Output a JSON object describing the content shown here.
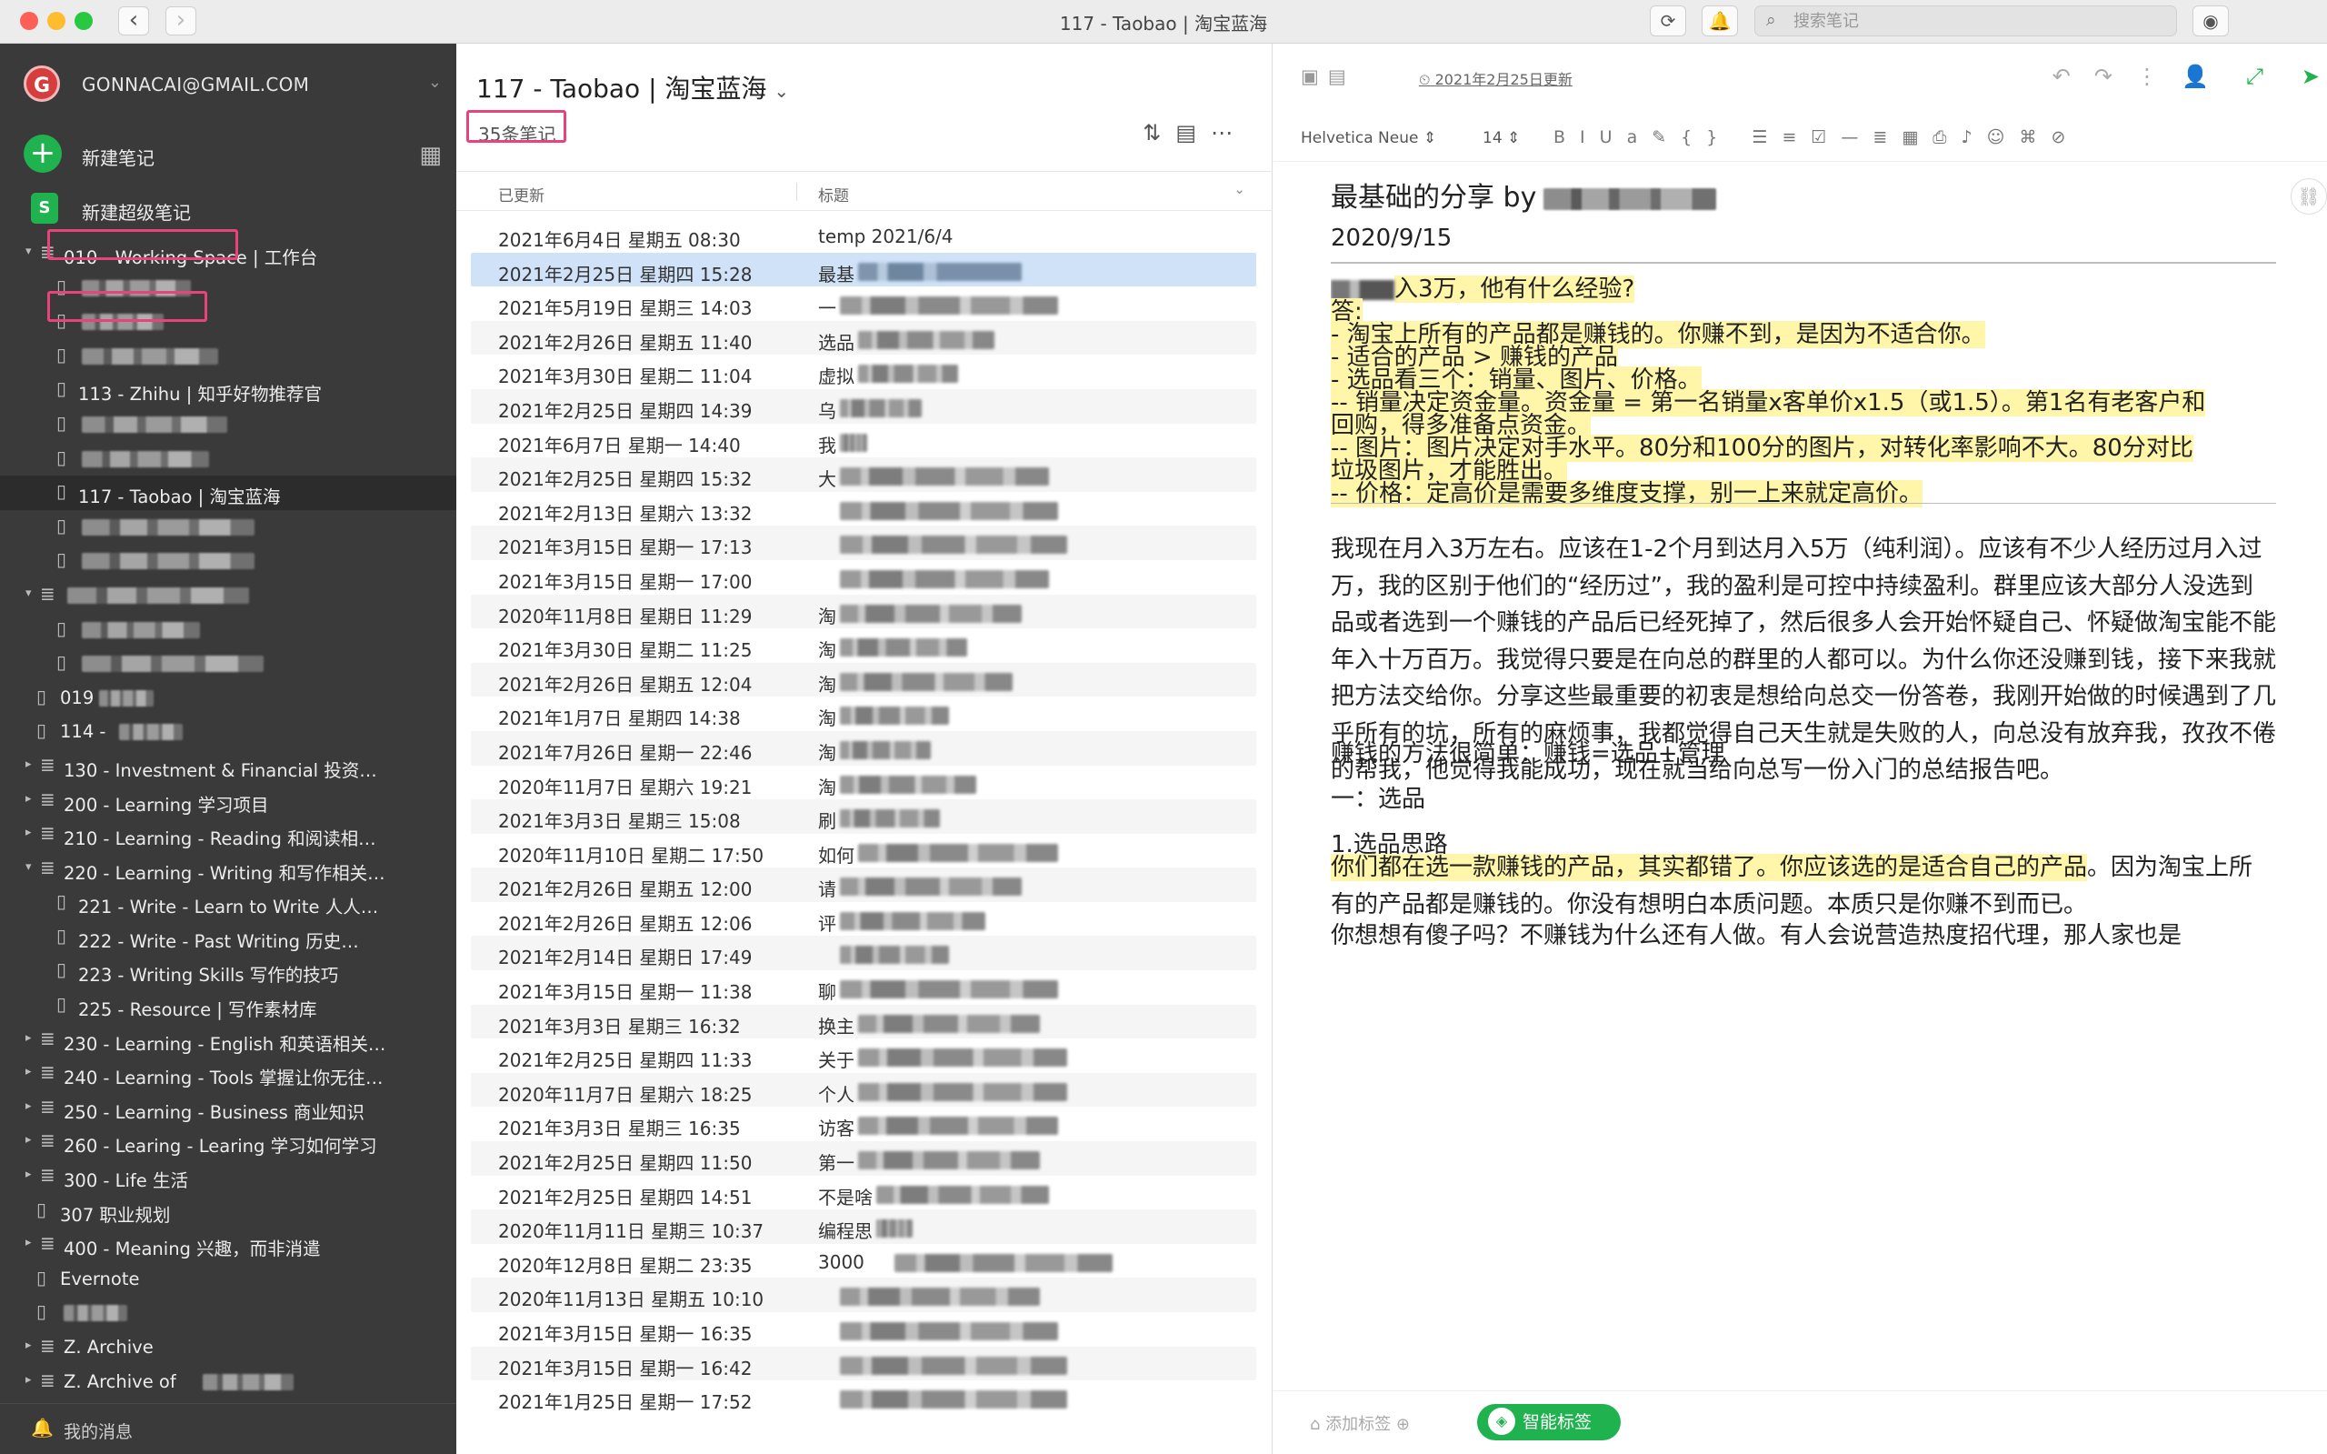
{
  "window": {
    "title": "117 - Taobao | 淘宝蓝海",
    "search_placeholder": "搜索笔记",
    "icons": {
      "sync": "sync-icon",
      "bell": "bell-icon",
      "search": "search-icon",
      "account": "account-icon"
    }
  },
  "sidebar": {
    "account_email": "GONNACAI@GMAIL.COM",
    "avatar_letter": "G",
    "new_note": "新建笔记",
    "new_super_note": "新建超级笔记",
    "super_icon_letter": "S",
    "footer": "我的消息",
    "tree": [
      {
        "label": "010 - Working Space | 工作台",
        "level": 0,
        "arrow": "▾",
        "icon": "stack"
      },
      {
        "label": "",
        "level": 1,
        "icon": "notebook",
        "blurred": 120
      },
      {
        "label": "",
        "level": 1,
        "icon": "notebook",
        "blurred": 90
      },
      {
        "label": "",
        "level": 1,
        "icon": "notebook",
        "blurred": 150
      },
      {
        "label": "113 - Zhihu | 知乎好物推荐官",
        "level": 1,
        "icon": "notebook"
      },
      {
        "label": "",
        "level": 1,
        "icon": "notebook",
        "blurred": 160
      },
      {
        "label": "",
        "level": 1,
        "icon": "notebook",
        "blurred": 140
      },
      {
        "label": "117 - Taobao | 淘宝蓝海",
        "level": 1,
        "icon": "notebook",
        "selected": true
      },
      {
        "label": "",
        "level": 1,
        "icon": "notebook",
        "blurred": 190
      },
      {
        "label": "",
        "level": 1,
        "icon": "notebook",
        "blurred": 190
      },
      {
        "label": "",
        "level": 0,
        "arrow": "▾",
        "icon": "stack",
        "blurred": 200
      },
      {
        "label": "",
        "level": 1,
        "icon": "notebook",
        "blurred": 130
      },
      {
        "label": "",
        "level": 1,
        "icon": "notebook",
        "blurred": 200
      },
      {
        "label": "019",
        "level": 0,
        "icon": "notebook",
        "blurred": 60
      },
      {
        "label": "114 -",
        "level": 0,
        "icon": "notebook",
        "blurred": 70
      },
      {
        "label": "130 - Investment & Financial  投资理…",
        "level": 0,
        "arrow": "▸",
        "icon": "stack"
      },
      {
        "label": "200 - Learning  学习项目",
        "level": 0,
        "arrow": "▸",
        "icon": "stack"
      },
      {
        "label": "210 - Learning - Reading 和阅读相关…",
        "level": 0,
        "arrow": "▸",
        "icon": "stack"
      },
      {
        "label": "220 - Learning - Writing 和写作相关…",
        "level": 0,
        "arrow": "▾",
        "icon": "stack"
      },
      {
        "label": "221 - Write - Learn to Write  人人…",
        "level": 1,
        "icon": "notebook"
      },
      {
        "label": "222 - Write - Past Writing  历史…",
        "level": 1,
        "icon": "notebook"
      },
      {
        "label": "223 - Writing Skills  写作的技巧",
        "level": 1,
        "icon": "notebook"
      },
      {
        "label": "225 - Resource | 写作素材库",
        "level": 1,
        "icon": "notebook"
      },
      {
        "label": "230 - Learning - English 和英语相关…",
        "level": 0,
        "arrow": "▸",
        "icon": "stack"
      },
      {
        "label": "240 - Learning - Tools 掌握让你无往…",
        "level": 0,
        "arrow": "▸",
        "icon": "stack"
      },
      {
        "label": "250 - Learning - Business  商业知识",
        "level": 0,
        "arrow": "▸",
        "icon": "stack"
      },
      {
        "label": "260 - Learing - Learing  学习如何学习",
        "level": 0,
        "arrow": "▸",
        "icon": "stack"
      },
      {
        "label": "300 - Life 生活",
        "level": 0,
        "arrow": "▸",
        "icon": "stack"
      },
      {
        "label": "307 职业规划",
        "level": 0,
        "icon": "notebook"
      },
      {
        "label": "400 - Meaning 兴趣，而非消遣",
        "level": 0,
        "arrow": "▸",
        "icon": "stack"
      },
      {
        "label": "Evernote",
        "level": 0,
        "icon": "notebook"
      },
      {
        "label": "",
        "level": 0,
        "icon": "notebook",
        "blurred": 70
      },
      {
        "label": "Z. Archive",
        "level": 0,
        "arrow": "▸",
        "icon": "stack"
      },
      {
        "label": "Z. Archive of",
        "level": 0,
        "arrow": "▸",
        "icon": "stack",
        "blurred": 100
      }
    ]
  },
  "notelist": {
    "title": "117 - Taobao | 淘宝蓝海",
    "count": "35条笔记",
    "col_updated": "已更新",
    "col_title": "标题",
    "rows": [
      {
        "date": "2021年6月4日 星期五 08:30",
        "title": "temp 2021/6/4",
        "blur": 0
      },
      {
        "date": "2021年2月25日 星期四 15:28",
        "title": "最基",
        "blur": 180,
        "selected": true
      },
      {
        "date": "2021年5月19日 星期三 14:03",
        "title": "一",
        "blur": 240
      },
      {
        "date": "2021年2月26日 星期五 11:40",
        "title": "选品",
        "blur": 150
      },
      {
        "date": "2021年3月30日 星期二 11:04",
        "title": "虚拟",
        "blur": 110
      },
      {
        "date": "2021年2月25日 星期四 14:39",
        "title": "乌",
        "blur": 90
      },
      {
        "date": "2021年6月7日 星期一 14:40",
        "title": "我",
        "blur": 30
      },
      {
        "date": "2021年2月25日 星期四 15:32",
        "title": "大",
        "blur": 230
      },
      {
        "date": "2021年2月13日 星期六 13:32",
        "title": "",
        "blur": 240
      },
      {
        "date": "2021年3月15日 星期一 17:13",
        "title": "",
        "blur": 250
      },
      {
        "date": "2021年3月15日 星期一 17:00",
        "title": "",
        "blur": 230
      },
      {
        "date": "2020年11月8日 星期日 11:29",
        "title": "淘",
        "blur": 200
      },
      {
        "date": "2021年3月30日 星期二 11:25",
        "title": "淘",
        "blur": 140
      },
      {
        "date": "2021年2月26日 星期五 12:04",
        "title": "淘",
        "blur": 190
      },
      {
        "date": "2021年1月7日 星期四 14:38",
        "title": "淘",
        "blur": 120
      },
      {
        "date": "2021年7月26日 星期一 22:46",
        "title": "淘",
        "blur": 100
      },
      {
        "date": "2020年11月7日 星期六 19:21",
        "title": "淘",
        "blur": 150
      },
      {
        "date": "2021年3月3日 星期三 15:08",
        "title": "刷",
        "blur": 110
      },
      {
        "date": "2020年11月10日 星期二 17:50",
        "title": "如何",
        "blur": 220
      },
      {
        "date": "2021年2月26日 星期五 12:00",
        "title": "请",
        "blur": 200
      },
      {
        "date": "2021年2月26日 星期五 12:06",
        "title": "评",
        "blur": 160
      },
      {
        "date": "2021年2月14日 星期日 17:49",
        "title": "",
        "blur": 120
      },
      {
        "date": "2021年3月15日 星期一 11:38",
        "title": "聊",
        "blur": 240
      },
      {
        "date": "2021年3月3日 星期三 16:32",
        "title": "换主",
        "blur": 200
      },
      {
        "date": "2021年2月25日 星期四 11:33",
        "title": "关于",
        "blur": 230
      },
      {
        "date": "2020年11月7日 星期六 18:25",
        "title": "个人",
        "blur": 230
      },
      {
        "date": "2021年3月3日 星期三 16:35",
        "title": "访客",
        "blur": 220
      },
      {
        "date": "2021年2月25日 星期四 11:50",
        "title": "第一",
        "blur": 200
      },
      {
        "date": "2021年2月25日 星期四 14:51",
        "title": "不是啥",
        "blur": 190
      },
      {
        "date": "2020年11月11日 星期三 10:37",
        "title": "编程思",
        "blur": 40
      },
      {
        "date": "2020年12月8日 星期二 23:35",
        "title": "3000",
        "blur": 240
      },
      {
        "date": "2020年11月13日 星期五 10:10",
        "title": "",
        "blur": 220
      },
      {
        "date": "2021年3月15日 星期一 16:35",
        "title": "",
        "blur": 240
      },
      {
        "date": "2021年3月15日 星期一 16:42",
        "title": "",
        "blur": 250
      },
      {
        "date": "2021年1月25日 星期一 17:52",
        "title": "",
        "blur": 250
      }
    ]
  },
  "editor": {
    "updated": "2021年2月25日更新",
    "font": "Helvetica Neue",
    "font_size": "14",
    "doc_title": "最基础的分享 by",
    "date": "2020/9/15",
    "qa": [
      "入3万，他有什么经验?",
      "答:",
      "- 淘宝上所有的产品都是赚钱的。你赚不到，是因为不适合你。",
      "- 适合的产品 > 赚钱的产品",
      "- 选品看三个：销量、图片、价格。",
      "-- 销量决定资金量。资金量 = 第一名销量x客单价x1.5（或1.5）。第1名有老客户和",
      "回购，得多准备点资金。",
      "-- 图片：图片决定对手水平。80分和100分的图片，对转化率影响不大。80分对比",
      "垃圾图片，才能胜出。",
      "-- 价格：定高价是需要多维度支撑，别一上来就定高价。"
    ],
    "para1": "我现在月入3万左右。应该在1-2个月到达月入5万（纯利润）。应该有不少人经历过月入过万，我的区别于他们的“经历过”，我的盈利是可控中持续盈利。群里应该大部分人没选到品或者选到一个赚钱的产品后已经死掉了，然后很多人会开始怀疑自己、怀疑做淘宝能不能年入十万百万。我觉得只要是在向总的群里的人都可以。为什么你还没赚到钱，接下来我就把方法交给你。分享这些最重要的初衷是想给向总交一份答卷，我刚开始做的时候遇到了几乎所有的坑，所有的麻烦事，我都觉得自己天生就是失败的人，向总没有放弃我，孜孜不倦的帮我，他觉得我能成功，现在就当给向总写一份入门的总结报告吧。",
    "para2": "赚钱的方法很简单：赚钱=选品+管理",
    "para3": "一：选品",
    "para4": "1.选品思路",
    "para5_hl": "你们都在选一款赚钱的产品，其实都错了。你应该选的是适合自己的产品",
    "para5_rest": "。因为淘宝上所有的产品都是赚钱的。你没有想明白本质问题。本质只是你赚不到而已。",
    "para6": "你想想有傻子吗？不赚钱为什么还有人做。有人会说营造热度招代理，那人家也是",
    "add_tag": "添加标签",
    "smart_tag": "智能标签"
  },
  "colors": {
    "brand_green": "#1fb24f",
    "highlight": "#fff6a9",
    "annotation_pink": "#e8437a",
    "selected_row": "#cfe2f7"
  }
}
